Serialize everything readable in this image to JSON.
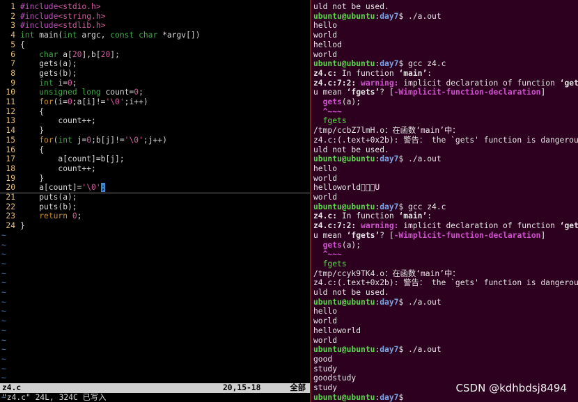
{
  "vim": {
    "lines": [
      {
        "n": "1",
        "segs": [
          {
            "t": "#include",
            "c": "pp"
          },
          {
            "t": "<stdio.h>",
            "c": "st"
          }
        ]
      },
      {
        "n": "2",
        "segs": [
          {
            "t": "#include",
            "c": "pp"
          },
          {
            "t": "<string.h>",
            "c": "st"
          }
        ]
      },
      {
        "n": "3",
        "segs": [
          {
            "t": "#include",
            "c": "pp"
          },
          {
            "t": "<stdlib.h>",
            "c": "st"
          }
        ]
      },
      {
        "n": "4",
        "segs": [
          {
            "t": "int",
            "c": "ty"
          },
          {
            "t": " main(",
            "c": ""
          },
          {
            "t": "int",
            "c": "ty"
          },
          {
            "t": " argc, ",
            "c": ""
          },
          {
            "t": "const",
            "c": "ty"
          },
          {
            "t": " ",
            "c": ""
          },
          {
            "t": "char",
            "c": "ty"
          },
          {
            "t": " *argv[])",
            "c": ""
          }
        ]
      },
      {
        "n": "5",
        "segs": [
          {
            "t": "{",
            "c": ""
          }
        ]
      },
      {
        "n": "6",
        "segs": [
          {
            "t": "    ",
            "c": ""
          },
          {
            "t": "char",
            "c": "ty"
          },
          {
            "t": " a[",
            "c": ""
          },
          {
            "t": "20",
            "c": "nm"
          },
          {
            "t": "],b[",
            "c": ""
          },
          {
            "t": "20",
            "c": "nm"
          },
          {
            "t": "];",
            "c": ""
          }
        ]
      },
      {
        "n": "7",
        "segs": [
          {
            "t": "    gets(a);",
            "c": ""
          }
        ]
      },
      {
        "n": "8",
        "segs": [
          {
            "t": "    gets(b);",
            "c": ""
          }
        ]
      },
      {
        "n": "9",
        "segs": [
          {
            "t": "    ",
            "c": ""
          },
          {
            "t": "int",
            "c": "ty"
          },
          {
            "t": " i=",
            "c": ""
          },
          {
            "t": "0",
            "c": "nm"
          },
          {
            "t": ";",
            "c": ""
          }
        ]
      },
      {
        "n": "10",
        "segs": [
          {
            "t": "    ",
            "c": ""
          },
          {
            "t": "unsigned",
            "c": "ty"
          },
          {
            "t": " ",
            "c": ""
          },
          {
            "t": "long",
            "c": "ty"
          },
          {
            "t": " count=",
            "c": ""
          },
          {
            "t": "0",
            "c": "nm"
          },
          {
            "t": ";",
            "c": ""
          }
        ]
      },
      {
        "n": "11",
        "segs": [
          {
            "t": "    ",
            "c": ""
          },
          {
            "t": "for",
            "c": "kw"
          },
          {
            "t": "(i=",
            "c": ""
          },
          {
            "t": "0",
            "c": "nm"
          },
          {
            "t": ";a[i]!=",
            "c": ""
          },
          {
            "t": "'\\0'",
            "c": "nm"
          },
          {
            "t": ";i++)",
            "c": ""
          }
        ]
      },
      {
        "n": "12",
        "segs": [
          {
            "t": "    {",
            "c": ""
          }
        ]
      },
      {
        "n": "13",
        "segs": [
          {
            "t": "        count++;",
            "c": ""
          }
        ]
      },
      {
        "n": "14",
        "segs": [
          {
            "t": "    }",
            "c": ""
          }
        ]
      },
      {
        "n": "15",
        "segs": [
          {
            "t": "    ",
            "c": ""
          },
          {
            "t": "for",
            "c": "kw"
          },
          {
            "t": "(",
            "c": ""
          },
          {
            "t": "int",
            "c": "ty"
          },
          {
            "t": " j=",
            "c": ""
          },
          {
            "t": "0",
            "c": "nm"
          },
          {
            "t": ";b[j]!=",
            "c": ""
          },
          {
            "t": "'\\0'",
            "c": "nm"
          },
          {
            "t": ";j++)",
            "c": ""
          }
        ]
      },
      {
        "n": "16",
        "segs": [
          {
            "t": "    {",
            "c": ""
          }
        ]
      },
      {
        "n": "17",
        "segs": [
          {
            "t": "        a[count]=b[j];",
            "c": ""
          }
        ]
      },
      {
        "n": "18",
        "segs": [
          {
            "t": "        count++;",
            "c": ""
          }
        ]
      },
      {
        "n": "19",
        "segs": [
          {
            "t": "    }",
            "c": ""
          }
        ]
      },
      {
        "n": "20",
        "cur": true,
        "segs": [
          {
            "t": "    a[count]=",
            "c": ""
          },
          {
            "t": "'\\0'",
            "c": "nm"
          },
          {
            "t": ";",
            "c": "cursor"
          }
        ]
      },
      {
        "n": "21",
        "segs": [
          {
            "t": "    puts(a);",
            "c": ""
          }
        ]
      },
      {
        "n": "22",
        "segs": [
          {
            "t": "    puts(b);",
            "c": ""
          }
        ]
      },
      {
        "n": "23",
        "segs": [
          {
            "t": "    ",
            "c": ""
          },
          {
            "t": "return",
            "c": "kw"
          },
          {
            "t": " ",
            "c": ""
          },
          {
            "t": "0",
            "c": "nm"
          },
          {
            "t": ";",
            "c": ""
          }
        ]
      },
      {
        "n": "24",
        "segs": [
          {
            "t": "}",
            "c": ""
          }
        ]
      }
    ],
    "tilde_count": 19,
    "status": {
      "file": "z4.c",
      "position": "20,15-18",
      "scroll": "全部"
    },
    "message": "\"z4.c\" 24L, 324C 已写入"
  },
  "terminal": {
    "lines": [
      [
        {
          "t": "uld not be used.",
          "c": ""
        }
      ],
      [
        {
          "t": "ubuntu@ubuntu",
          "c": "pu"
        },
        {
          "t": ":",
          "c": ""
        },
        {
          "t": "day7",
          "c": "pd"
        },
        {
          "t": "$ ./a.out",
          "c": ""
        }
      ],
      [
        {
          "t": "hello",
          "c": ""
        }
      ],
      [
        {
          "t": "world",
          "c": ""
        }
      ],
      [
        {
          "t": "hellod",
          "c": ""
        }
      ],
      [
        {
          "t": "world",
          "c": ""
        }
      ],
      [
        {
          "t": "ubuntu@ubuntu",
          "c": "pu"
        },
        {
          "t": ":",
          "c": ""
        },
        {
          "t": "day7",
          "c": "pd"
        },
        {
          "t": "$ gcc z4.c",
          "c": ""
        }
      ],
      [
        {
          "t": "z4.c:",
          "c": "b"
        },
        {
          "t": " In function ",
          "c": ""
        },
        {
          "t": "‘main’",
          "c": "b"
        },
        {
          "t": ":",
          "c": ""
        }
      ],
      [
        {
          "t": "z4.c:7:2: ",
          "c": "b"
        },
        {
          "t": "warning: ",
          "c": "mag"
        },
        {
          "t": "implicit declaration of function ",
          "c": ""
        },
        {
          "t": "‘gets",
          "c": "b"
        }
      ],
      [
        {
          "t": "u mean ",
          "c": ""
        },
        {
          "t": "‘fgets’",
          "c": "b"
        },
        {
          "t": "? [",
          "c": ""
        },
        {
          "t": "-Wimplicit-function-declaration",
          "c": "mag"
        },
        {
          "t": "]",
          "c": ""
        }
      ],
      [
        {
          "t": "  ",
          "c": ""
        },
        {
          "t": "gets",
          "c": "mag"
        },
        {
          "t": "(a);",
          "c": ""
        }
      ],
      [
        {
          "t": "  ",
          "c": ""
        },
        {
          "t": "^~~~",
          "c": "mag"
        }
      ],
      [
        {
          "t": "  ",
          "c": ""
        },
        {
          "t": "fgets",
          "c": "grn"
        }
      ],
      [
        {
          "t": "/tmp/ccbZ7lmH.o：在函数‘main’中：",
          "c": ""
        }
      ],
      [
        {
          "t": "z4.c:(.text+0x2b): 警告： the `gets' function is dangerous",
          "c": ""
        }
      ],
      [
        {
          "t": "uld not be used.",
          "c": ""
        }
      ],
      [
        {
          "t": "ubuntu@ubuntu",
          "c": "pu"
        },
        {
          "t": ":",
          "c": ""
        },
        {
          "t": "day7",
          "c": "pd"
        },
        {
          "t": "$ ./a.out",
          "c": ""
        }
      ],
      [
        {
          "t": "hello",
          "c": ""
        }
      ],
      [
        {
          "t": "world",
          "c": ""
        }
      ],
      [
        {
          "t": "helloworld\u0000\u0010\u0000U",
          "c": ""
        }
      ],
      [
        {
          "t": "world",
          "c": ""
        }
      ],
      [
        {
          "t": "ubuntu@ubuntu",
          "c": "pu"
        },
        {
          "t": ":",
          "c": ""
        },
        {
          "t": "day7",
          "c": "pd"
        },
        {
          "t": "$ gcc z4.c",
          "c": ""
        }
      ],
      [
        {
          "t": "z4.c:",
          "c": "b"
        },
        {
          "t": " In function ",
          "c": ""
        },
        {
          "t": "‘main’",
          "c": "b"
        },
        {
          "t": ":",
          "c": ""
        }
      ],
      [
        {
          "t": "z4.c:7:2: ",
          "c": "b"
        },
        {
          "t": "warning: ",
          "c": "mag"
        },
        {
          "t": "implicit declaration of function ",
          "c": ""
        },
        {
          "t": "‘gets",
          "c": "b"
        }
      ],
      [
        {
          "t": "u mean ",
          "c": ""
        },
        {
          "t": "‘fgets’",
          "c": "b"
        },
        {
          "t": "? [",
          "c": ""
        },
        {
          "t": "-Wimplicit-function-declaration",
          "c": "mag"
        },
        {
          "t": "]",
          "c": ""
        }
      ],
      [
        {
          "t": "  ",
          "c": ""
        },
        {
          "t": "gets",
          "c": "mag"
        },
        {
          "t": "(a);",
          "c": ""
        }
      ],
      [
        {
          "t": "  ",
          "c": ""
        },
        {
          "t": "^~~~",
          "c": "mag"
        }
      ],
      [
        {
          "t": "  ",
          "c": ""
        },
        {
          "t": "fgets",
          "c": "grn"
        }
      ],
      [
        {
          "t": "/tmp/ccyk9TK4.o：在函数‘main’中：",
          "c": ""
        }
      ],
      [
        {
          "t": "z4.c:(.text+0x2b): 警告： the `gets' function is dangerous",
          "c": ""
        }
      ],
      [
        {
          "t": "uld not be used.",
          "c": ""
        }
      ],
      [
        {
          "t": "ubuntu@ubuntu",
          "c": "pu"
        },
        {
          "t": ":",
          "c": ""
        },
        {
          "t": "day7",
          "c": "pd"
        },
        {
          "t": "$ ./a.out",
          "c": ""
        }
      ],
      [
        {
          "t": "hello",
          "c": ""
        }
      ],
      [
        {
          "t": "world",
          "c": ""
        }
      ],
      [
        {
          "t": "helloworld",
          "c": ""
        }
      ],
      [
        {
          "t": "world",
          "c": ""
        }
      ],
      [
        {
          "t": "ubuntu@ubuntu",
          "c": "pu"
        },
        {
          "t": ":",
          "c": ""
        },
        {
          "t": "day7",
          "c": "pd"
        },
        {
          "t": "$ ./a.out",
          "c": ""
        }
      ],
      [
        {
          "t": "good",
          "c": ""
        }
      ],
      [
        {
          "t": "study",
          "c": ""
        }
      ],
      [
        {
          "t": "goodstudy",
          "c": ""
        }
      ],
      [
        {
          "t": "study",
          "c": ""
        }
      ],
      [
        {
          "t": "ubuntu@ubuntu",
          "c": "pu"
        },
        {
          "t": ":",
          "c": ""
        },
        {
          "t": "day7",
          "c": "pd"
        },
        {
          "t": "$ ",
          "c": ""
        }
      ]
    ]
  },
  "watermark": "CSDN @kdhbdsj8494"
}
